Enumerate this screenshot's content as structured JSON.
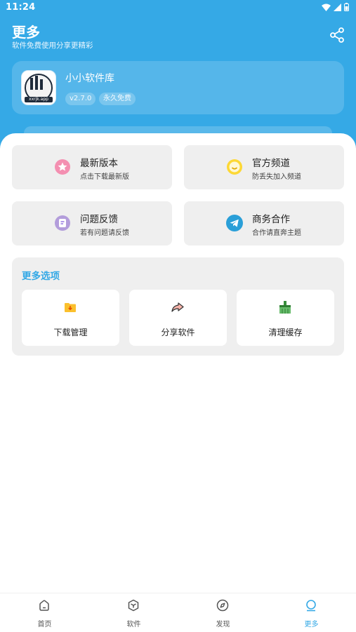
{
  "status_bar": {
    "time": "11:24"
  },
  "header": {
    "title": "更多",
    "subtitle": "软件免费使用分享更精彩"
  },
  "app": {
    "name": "小小软件库",
    "version": "v2.7.0",
    "tag": "永久免费",
    "logo_text": "xxrjk.app"
  },
  "tiles": [
    {
      "title": "最新版本",
      "sub": "点击下载最新版",
      "icon": "star-badge-icon",
      "color": "#f06292"
    },
    {
      "title": "官方频道",
      "sub": "防丢失加入频道",
      "icon": "smile-icon",
      "color": "#fbc02d"
    },
    {
      "title": "问题反馈",
      "sub": "若有问题请反馈",
      "icon": "feedback-icon",
      "color": "#9c7bea"
    },
    {
      "title": "商务合作",
      "sub": "合作请直奔主题",
      "icon": "telegram-icon",
      "color": "#2a9fd8"
    }
  ],
  "more": {
    "title": "更多选项",
    "options": [
      {
        "label": "下载管理",
        "icon": "download-folder-icon"
      },
      {
        "label": "分享软件",
        "icon": "share-arrow-icon"
      },
      {
        "label": "清理缓存",
        "icon": "broom-icon"
      }
    ]
  },
  "nav": [
    {
      "label": "首页",
      "icon": "home-icon"
    },
    {
      "label": "软件",
      "icon": "box-icon"
    },
    {
      "label": "发现",
      "icon": "compass-icon"
    },
    {
      "label": "更多",
      "icon": "more-icon",
      "active": true
    }
  ],
  "colors": {
    "primary": "#35a9e6",
    "tile_bg": "#efefef"
  }
}
